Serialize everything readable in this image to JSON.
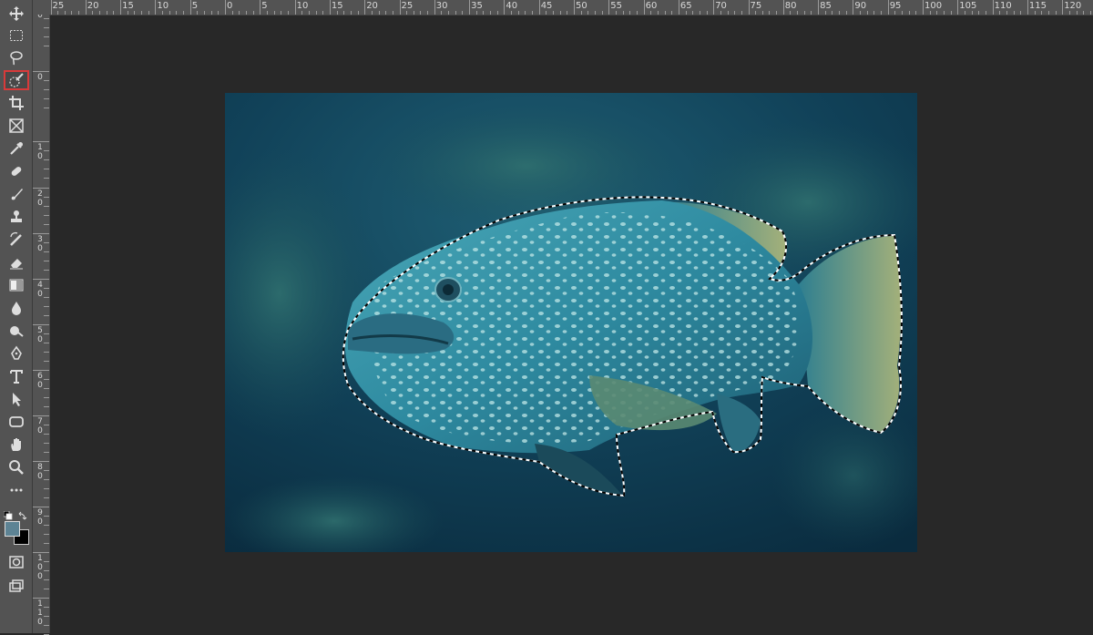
{
  "colors": {
    "toolbar_bg": "#535353",
    "workspace_bg": "#282828",
    "active_tool_outline": "#d83a3a",
    "foreground_swatch": "#5d8394",
    "background_swatch": "#000000"
  },
  "toolbar": {
    "tools": [
      {
        "name": "move-tool-icon"
      },
      {
        "name": "marquee-tool-icon"
      },
      {
        "name": "lasso-tool-icon"
      },
      {
        "name": "quick-selection-tool-icon",
        "active": true
      },
      {
        "name": "crop-tool-icon"
      },
      {
        "name": "frame-tool-icon"
      },
      {
        "name": "eyedropper-tool-icon"
      },
      {
        "name": "healing-brush-tool-icon"
      },
      {
        "name": "brush-tool-icon"
      },
      {
        "name": "clone-stamp-tool-icon"
      },
      {
        "name": "history-brush-tool-icon"
      },
      {
        "name": "eraser-tool-icon"
      },
      {
        "name": "gradient-tool-icon"
      },
      {
        "name": "blur-tool-icon"
      },
      {
        "name": "dodge-tool-icon"
      },
      {
        "name": "pen-tool-icon"
      },
      {
        "name": "type-tool-icon",
        "glyph": "T"
      },
      {
        "name": "path-selection-tool-icon"
      },
      {
        "name": "rectangle-tool-icon"
      },
      {
        "name": "hand-tool-icon"
      },
      {
        "name": "zoom-tool-icon"
      },
      {
        "name": "more-tools-icon"
      }
    ]
  },
  "ruler_h": {
    "labels": [
      "25",
      "20",
      "15",
      "10",
      "5",
      "0",
      "5",
      "10",
      "15",
      "20",
      "25",
      "30",
      "35",
      "40",
      "45",
      "50",
      "55",
      "60",
      "65",
      "70",
      "75",
      "80",
      "85",
      "90",
      "95",
      "100",
      "105",
      "110",
      "115",
      "120"
    ]
  },
  "ruler_v": {
    "labels": [
      "0",
      "0",
      "1\n0",
      "2\n0",
      "3\n0",
      "4\n0",
      "5\n0",
      "6\n0",
      "7\n0",
      "8\n0",
      "9\n0",
      "1\n0\n0",
      "1\n1\n0"
    ]
  },
  "document": {
    "image_subject": "grouper-fish-underwater",
    "selection": "marching-ants-around-fish"
  }
}
